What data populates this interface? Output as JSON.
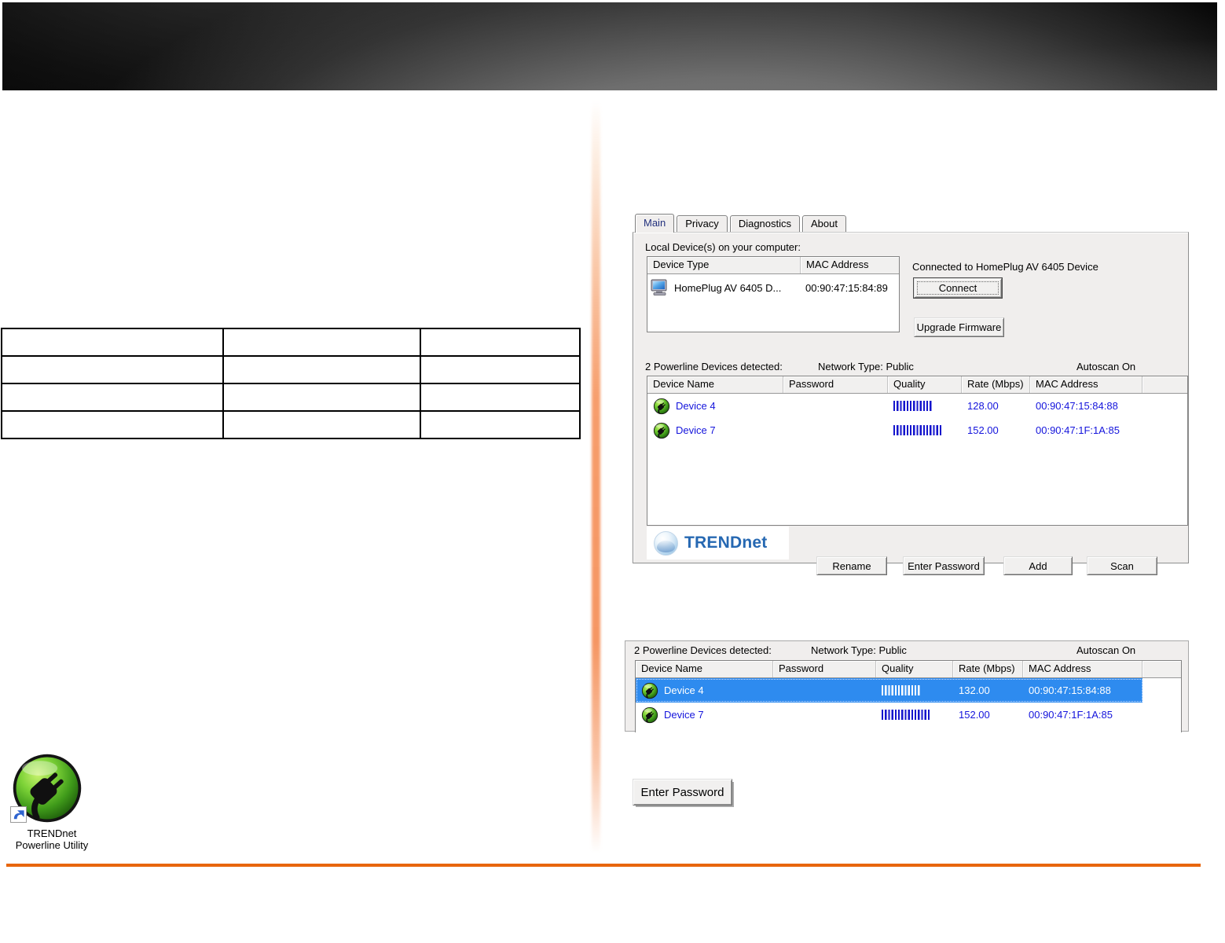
{
  "colors": {
    "accent_orange": "#E8660D",
    "selection_blue": "#2E8BEF",
    "device_text_blue": "#1414DC",
    "logo_blue": "#2668B2"
  },
  "utility_window": {
    "tabs": [
      {
        "label": "Main",
        "active": true
      },
      {
        "label": "Privacy",
        "active": false
      },
      {
        "label": "Diagnostics",
        "active": false
      },
      {
        "label": "About",
        "active": false
      }
    ],
    "local_devices": {
      "label": "Local Device(s) on your computer:",
      "columns": [
        "Device Type",
        "MAC Address"
      ],
      "row": {
        "device_type": "HomePlug AV 6405 D...",
        "mac": "00:90:47:15:84:89"
      }
    },
    "connection_status": "Connected to HomePlug AV 6405 Device",
    "connect_label": "Connect",
    "upgrade_label": "Upgrade Firmware",
    "status_bar": {
      "detected": "2 Powerline Devices detected:",
      "network_type": "Network Type: Public",
      "autoscan": "Autoscan On"
    },
    "device_list": {
      "columns": [
        "Device Name",
        "Password",
        "Quality",
        "Rate (Mbps)",
        "MAC Address"
      ],
      "rows": [
        {
          "name": "Device 4",
          "password": "",
          "quality_bars": 12,
          "rate": "128.00",
          "mac": "00:90:47:15:84:88",
          "selected": false
        },
        {
          "name": "Device 7",
          "password": "",
          "quality_bars": 15,
          "rate": "152.00",
          "mac": "00:90:47:1F:1A:85",
          "selected": false
        }
      ]
    },
    "logo_text": "TRENDnet",
    "action_buttons": [
      "Rename",
      "Enter Password",
      "Add",
      "Scan"
    ]
  },
  "devices_panel": {
    "status_bar": {
      "detected": "2 Powerline Devices detected:",
      "network_type": "Network Type: Public",
      "autoscan": "Autoscan On"
    },
    "columns": [
      "Device Name",
      "Password",
      "Quality",
      "Rate (Mbps)",
      "MAC Address"
    ],
    "rows": [
      {
        "name": "Device 4",
        "password": "",
        "quality_bars": 12,
        "rate": "132.00",
        "mac": "00:90:47:15:84:88",
        "selected": true
      },
      {
        "name": "Device 7",
        "password": "",
        "quality_bars": 15,
        "rate": "152.00",
        "mac": "00:90:47:1F:1A:85",
        "selected": false
      }
    ]
  },
  "enter_password_button": {
    "label": "Enter Password"
  },
  "desktop_icon": {
    "label_line1": "TRENDnet",
    "label_line2": "Powerline Utility"
  }
}
